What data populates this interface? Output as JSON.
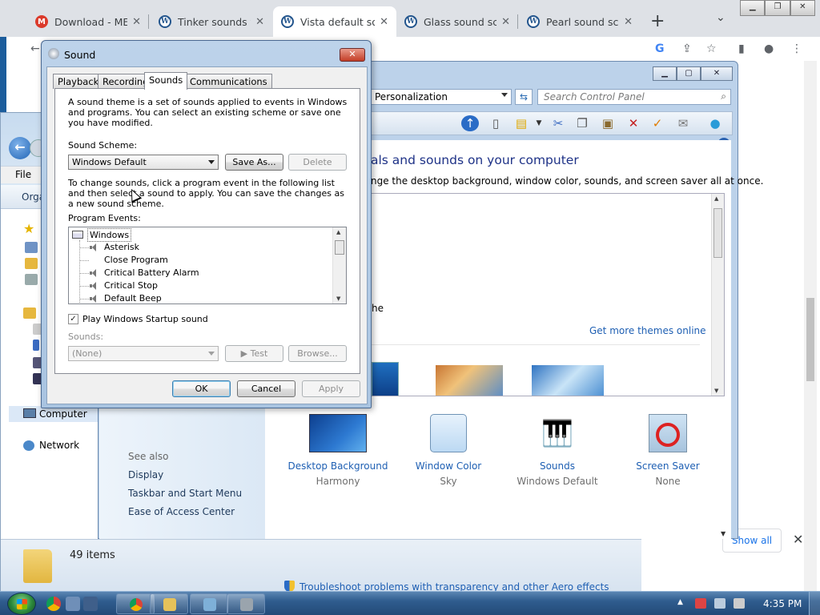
{
  "browser": {
    "tabs": [
      {
        "title": "Download - MEG",
        "favicon": "gmail-icon"
      },
      {
        "title": "Tinker sounds fo",
        "favicon": "wordpress-icon"
      },
      {
        "title": "Vista default sou",
        "favicon": "wordpress-icon"
      },
      {
        "title": "Glass sound sche",
        "favicon": "wordpress-icon"
      },
      {
        "title": "Pearl sound sche",
        "favicon": "wordpress-icon"
      }
    ],
    "new_tab": "+",
    "tab_close": "✕",
    "show_all": "Show all",
    "download_close": "✕"
  },
  "explorer": {
    "menu_file": "File",
    "organize": "Orga",
    "computer": "Computer",
    "network": "Network",
    "items": "49 items"
  },
  "control_panel": {
    "address": "Personalization",
    "search_placeholder": "Search Control Panel",
    "heading": "als and sounds on your computer",
    "subheading": "nge the desktop background, window color, sounds, and screen saver all at once.",
    "theme_fragment": "he",
    "get_more_themes": "Get more themes online",
    "bottom_items": [
      {
        "label": "Desktop Background",
        "value": "Harmony"
      },
      {
        "label": "Window Color",
        "value": "Sky"
      },
      {
        "label": "Sounds",
        "value": "Windows Default"
      },
      {
        "label": "Screen Saver",
        "value": "None"
      }
    ],
    "troubleshoot": "Troubleshoot problems with transparency and other Aero effects",
    "see_also": "See also",
    "links": [
      "Display",
      "Taskbar and Start Menu",
      "Ease of Access Center"
    ]
  },
  "dialog": {
    "title": "Sound",
    "tabs": [
      "Playback",
      "Recording",
      "Sounds",
      "Communications"
    ],
    "active_tab": "Sounds",
    "intro": "A sound theme is a set of sounds applied to events in Windows and programs.  You can select an existing scheme or save one you have modified.",
    "scheme_label": "Sound Scheme:",
    "scheme_value": "Windows Default",
    "save_as": "Save As...",
    "delete": "Delete",
    "instructions": "To change sounds, click a program event in the following list and then select a sound to apply.  You can save the changes as a new sound scheme.",
    "events_label": "Program Events:",
    "events_root": "Windows",
    "events": [
      {
        "name": "Asterisk",
        "has_sound": true
      },
      {
        "name": "Close Program",
        "has_sound": false
      },
      {
        "name": "Critical Battery Alarm",
        "has_sound": true
      },
      {
        "name": "Critical Stop",
        "has_sound": true
      },
      {
        "name": "Default Beep",
        "has_sound": true
      }
    ],
    "startup_checkbox": "Play Windows Startup sound",
    "startup_checked": true,
    "check_mark": "✓",
    "sounds_label": "Sounds:",
    "sounds_value": "(None)",
    "test": "Test",
    "browse": "Browse...",
    "ok": "OK",
    "cancel": "Cancel",
    "apply": "Apply",
    "close": "✕"
  },
  "taskbar": {
    "clock": "4:35 PM"
  }
}
